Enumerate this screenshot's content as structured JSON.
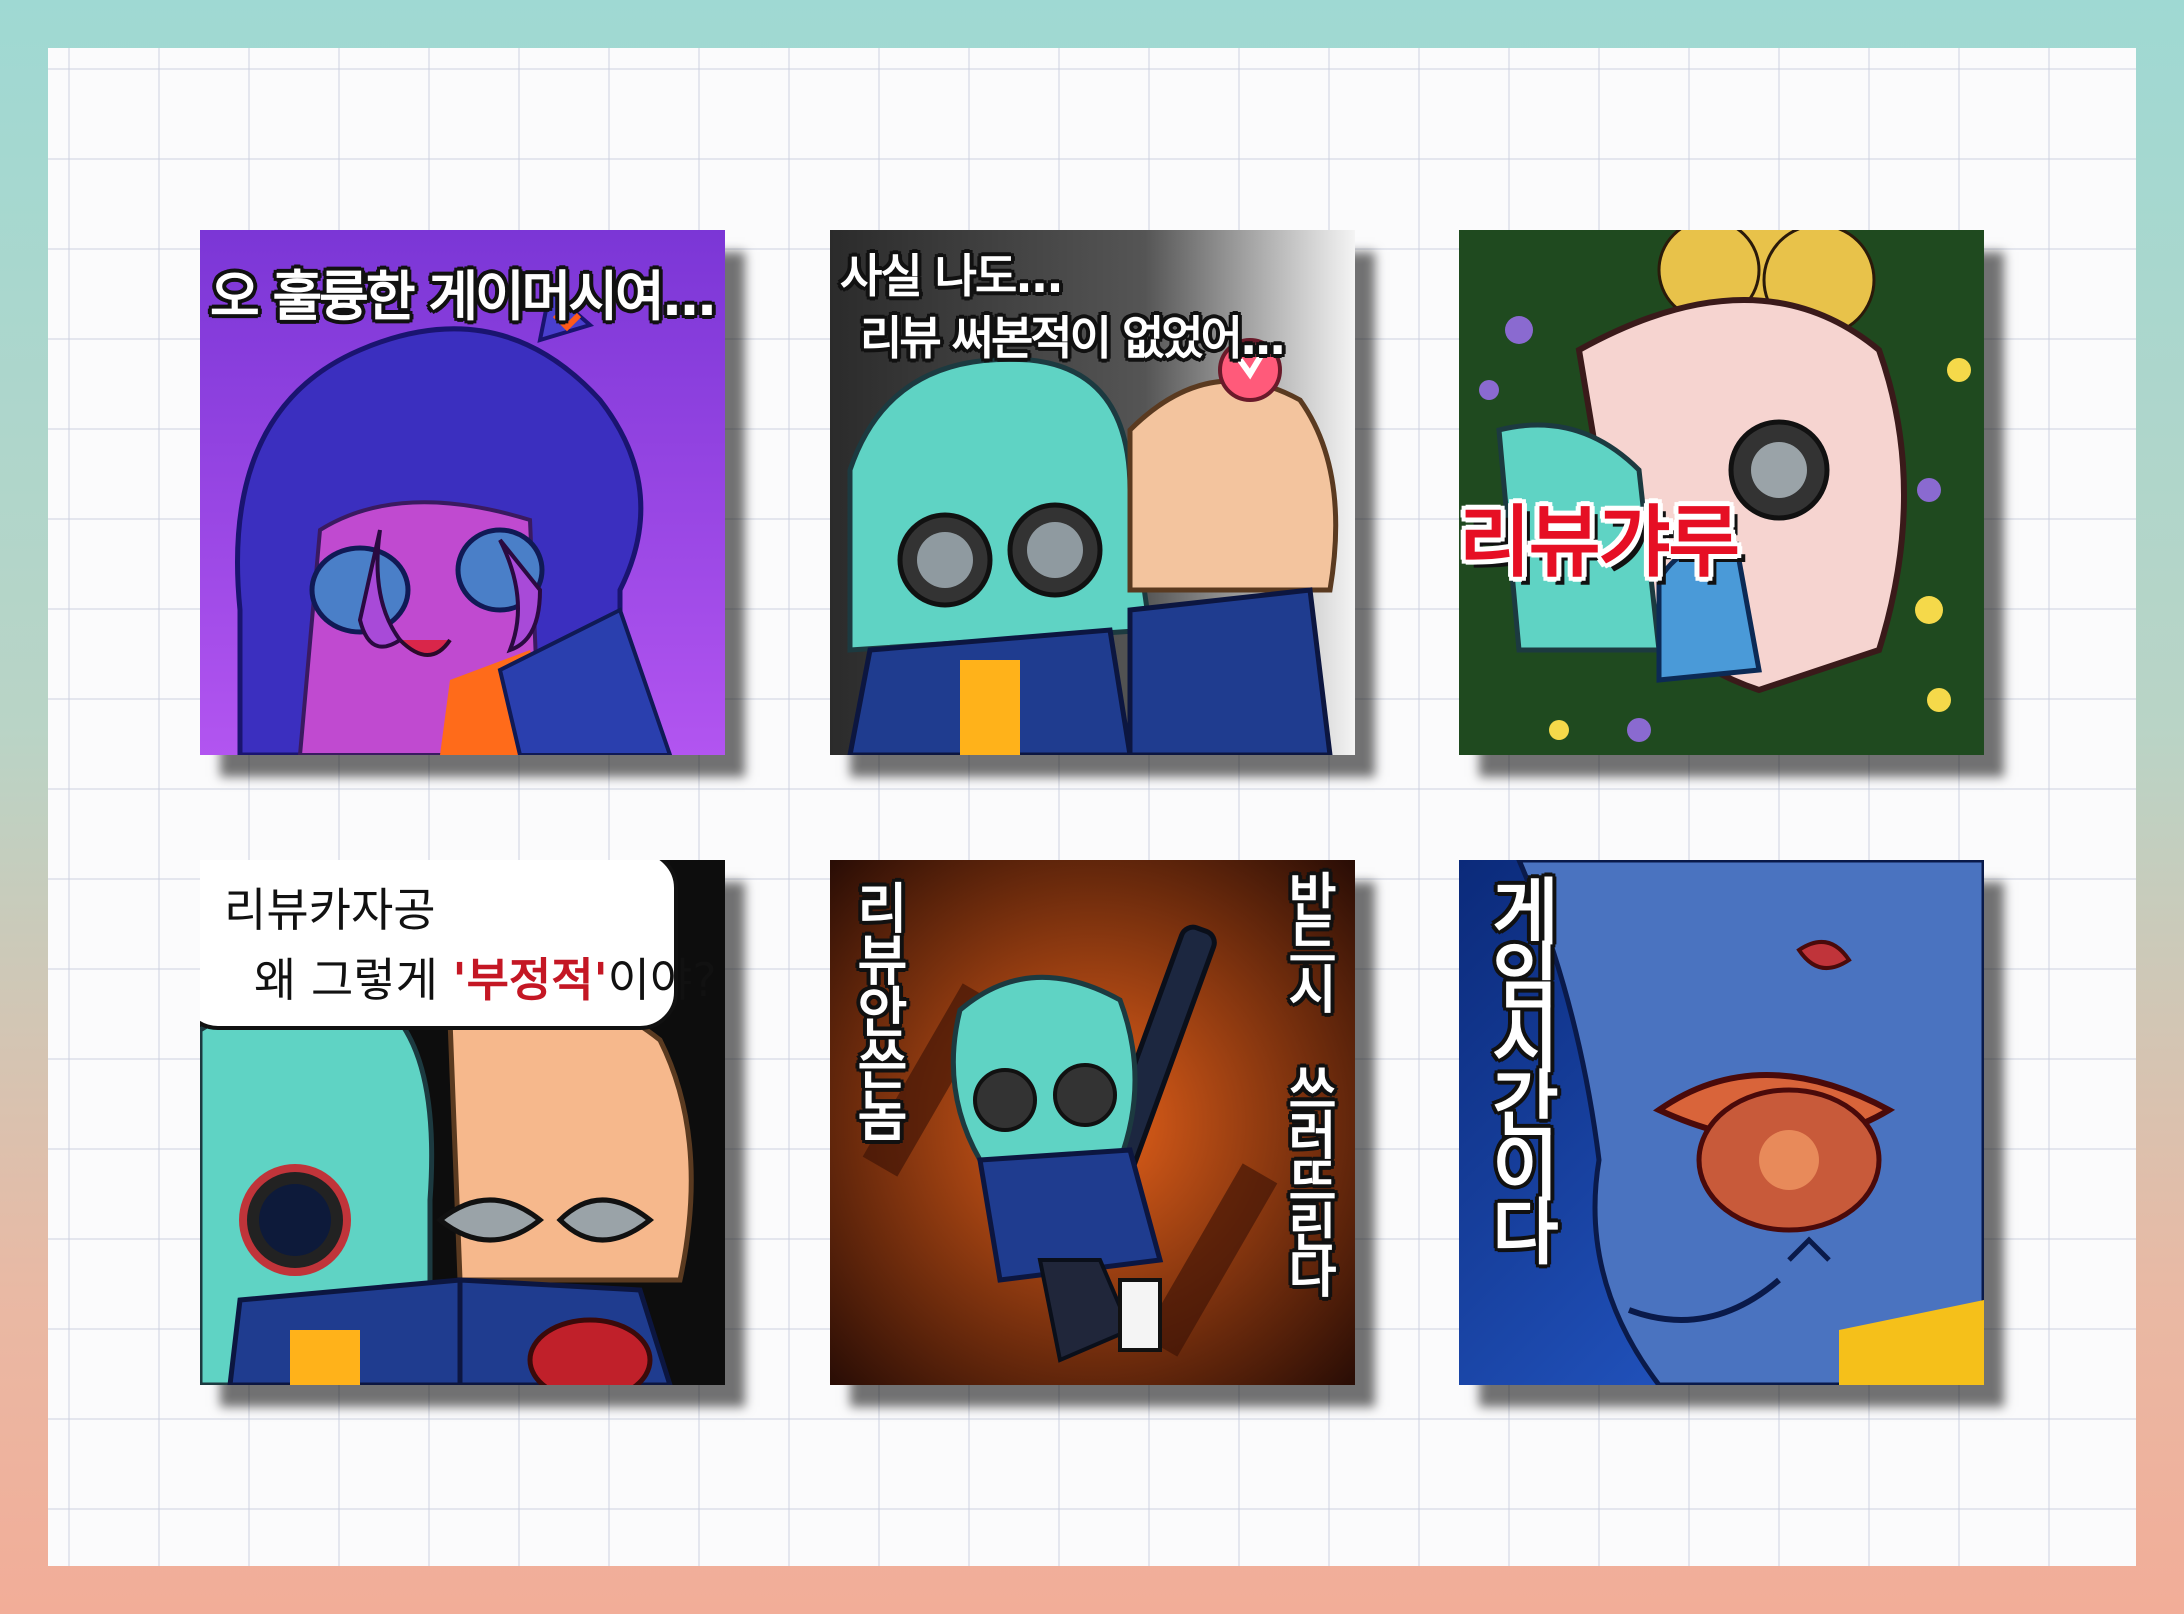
{
  "stickers": [
    {
      "caption": "오 훌륭한 게이머시여..."
    },
    {
      "caption_line1": "사실 나도...",
      "caption_line2": "리뷰 써본적이 없었어..."
    },
    {
      "caption": "리뷰갸루"
    },
    {
      "bubble_line1": "리뷰카자공",
      "bubble_line2_pre": "왜 그렇게 ",
      "bubble_line2_emph": "'부정적'",
      "bubble_line2_post": "이야?"
    },
    {
      "left_caption": "리뷰안쓴놈",
      "right_caption": "반드시 쓰러뜨린다"
    },
    {
      "caption": "게임시간이다"
    }
  ],
  "colors": {
    "sticker1_bg": "#8c2fd9",
    "sticker3_bg": "#1f4a1f",
    "caption_red": "#e60f24",
    "hair_teal": "#5fd3c4"
  }
}
